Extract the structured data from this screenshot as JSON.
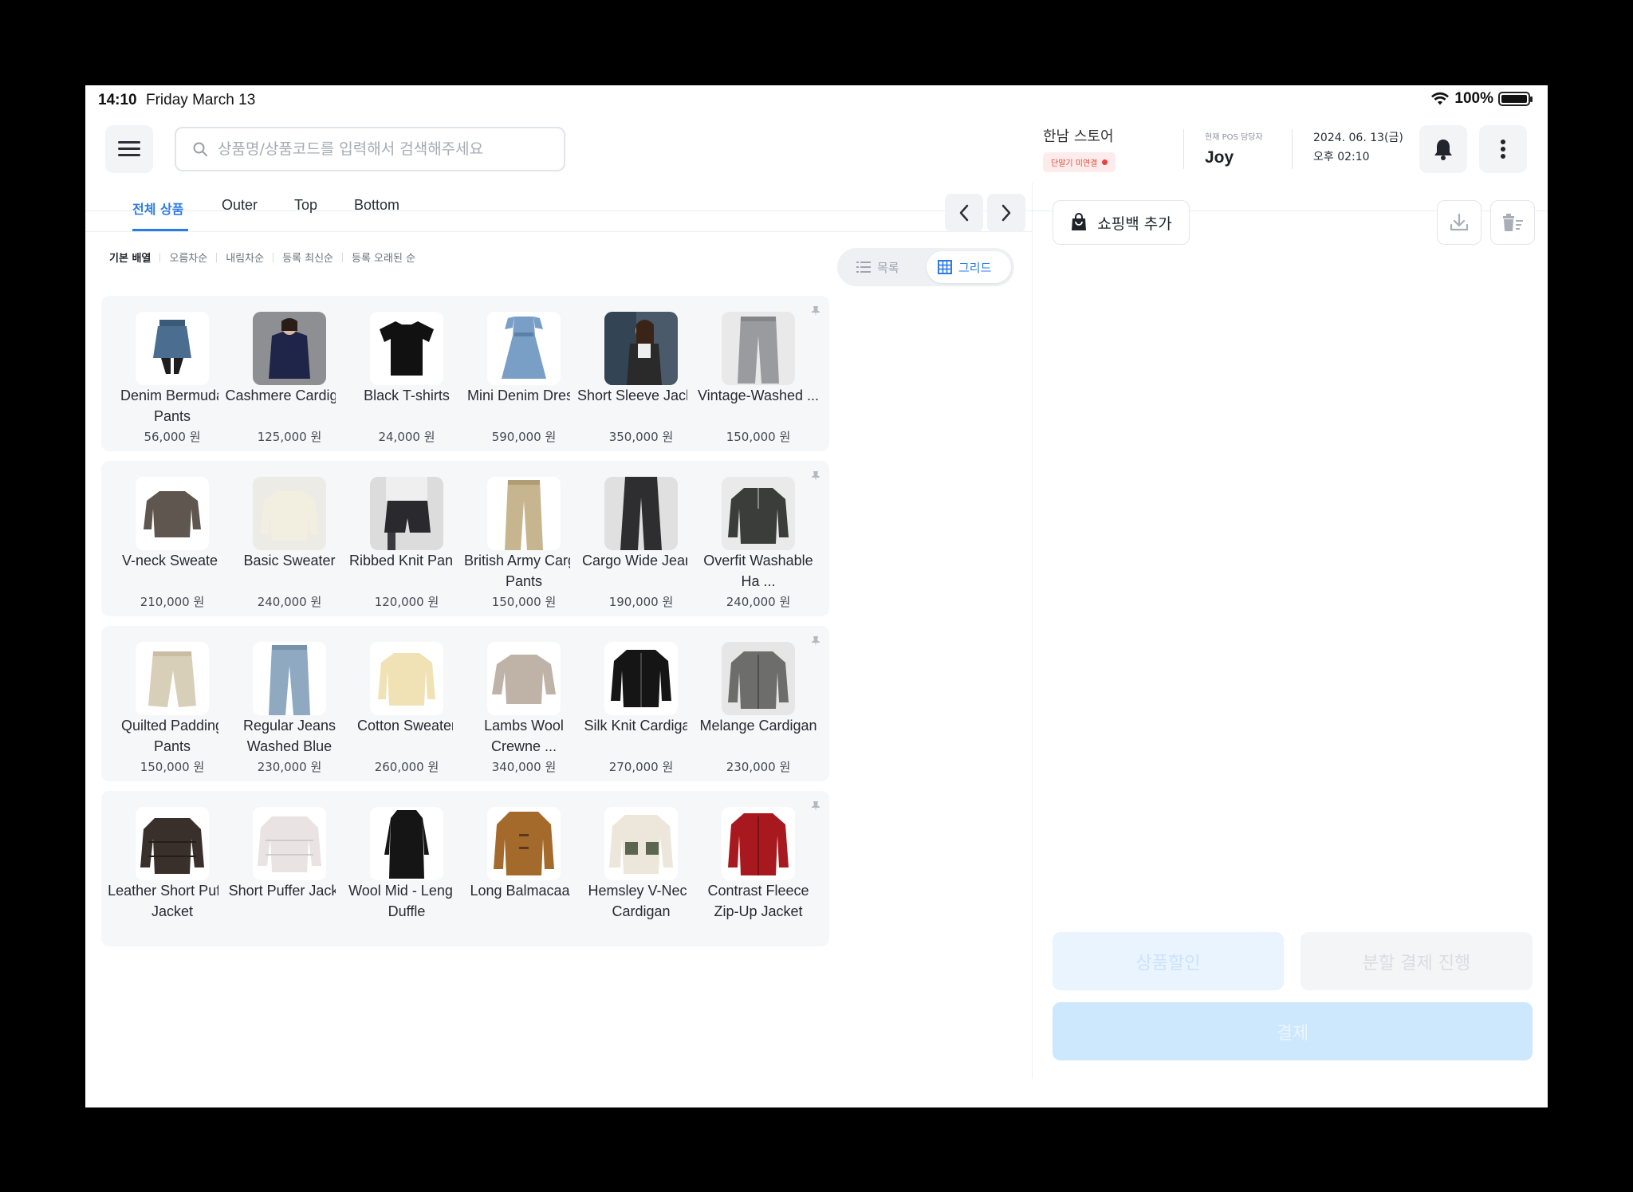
{
  "status_bar": {
    "time": "14:10",
    "date": "Friday March 13",
    "battery": "100%",
    "battery_level": 1.0
  },
  "header": {
    "search_placeholder": "상품명/상품코드를 입력해서 검색해주세요",
    "store_name": "한남 스토어",
    "store_status": "단말기 미연결",
    "staff_label": "현재 POS 담당자",
    "staff_name": "Joy",
    "date": "2024. 06. 13(금)",
    "time": "오후 02:10"
  },
  "tabs": [
    "전체 상품",
    "Outer",
    "Top",
    "Bottom"
  ],
  "active_tab": "전체 상품",
  "sorts": [
    "기본 배열",
    "오름차순",
    "내림차순",
    "등록 최신순",
    "등록 오래된 순"
  ],
  "active_sort": "기본 배열",
  "view": {
    "list_label": "목록",
    "grid_label": "그리드",
    "active": "grid"
  },
  "products": [
    {
      "name": "Denim Bermuda Pants",
      "price": "56,000 원",
      "pinned": true,
      "img": "denim-skirt"
    },
    {
      "name": "Cashmere Cardigan",
      "price": "125,000 원",
      "pinned": true,
      "img": "navy-cardigan"
    },
    {
      "name": "Black T-shirts",
      "price": "24,000 원",
      "pinned": true,
      "img": "black-tshirt"
    },
    {
      "name": "Mini Denim Dress",
      "price": "590,000 원",
      "pinned": false,
      "img": "denim-dress"
    },
    {
      "name": "Short Sleeve Jacket",
      "price": "350,000 원",
      "pinned": false,
      "img": "jacket-photo"
    },
    {
      "name": "Vintage-Washed ...",
      "price": "150,000 원",
      "pinned": false,
      "img": "grey-trousers"
    },
    {
      "name": "V-neck Sweater",
      "price": "210,000 원",
      "pinned": false,
      "img": "brown-sweater"
    },
    {
      "name": "Basic Sweater",
      "price": "240,000 원",
      "pinned": false,
      "img": "cream-sweater"
    },
    {
      "name": "Ribbed Knit Pants",
      "price": "120,000 원",
      "pinned": false,
      "img": "knit-shorts"
    },
    {
      "name": "British Army Cargo Pants",
      "price": "150,000 원",
      "pinned": false,
      "img": "khaki-pants"
    },
    {
      "name": "Cargo Wide Jeans",
      "price": "190,000 원",
      "pinned": false,
      "img": "black-wide-pants"
    },
    {
      "name": "Overfit Washable Ha ...",
      "price": "240,000 원",
      "pinned": false,
      "img": "dark-zip-knit"
    },
    {
      "name": "Quilted Padding Pants",
      "price": "150,000 원",
      "pinned": false,
      "img": "beige-padding-pants"
    },
    {
      "name": "Regular Jeans Washed Blue",
      "price": "230,000 원",
      "pinned": false,
      "img": "blue-jeans"
    },
    {
      "name": "Cotton Sweater",
      "price": "260,000 원",
      "pinned": false,
      "img": "yellow-sweater"
    },
    {
      "name": "Lambs Wool Crewne ...",
      "price": "340,000 원",
      "pinned": false,
      "img": "beige-crewneck"
    },
    {
      "name": "Silk Knit Cardigan",
      "price": "270,000 원",
      "pinned": false,
      "img": "black-cardigan"
    },
    {
      "name": "Melange Cardigan",
      "price": "230,000 원",
      "pinned": false,
      "img": "grey-cardigan"
    },
    {
      "name": "Leather Short Puffer Jacket",
      "price": "",
      "pinned": false,
      "img": "leather-puffer"
    },
    {
      "name": "Short Puffer Jacket",
      "price": "",
      "pinned": false,
      "img": "white-puffer"
    },
    {
      "name": "Wool Mid - Length Duffle",
      "price": "",
      "pinned": false,
      "img": "black-coat"
    },
    {
      "name": "Long Balmacaan",
      "price": "",
      "pinned": false,
      "img": "brown-duffle"
    },
    {
      "name": "Hemsley V-Neck Cardigan",
      "price": "",
      "pinned": false,
      "img": "fleece-cardigan"
    },
    {
      "name": "Contrast Fleece Zip-Up Jacket",
      "price": "",
      "pinned": false,
      "img": "red-cardigan"
    }
  ],
  "right_panel": {
    "shopping_bag": "쇼핑백 추가",
    "discount": "상품할인",
    "split_pay": "분할 결제 진행",
    "checkout": "결제"
  },
  "colors": {
    "accent": "#2c7be5",
    "status_error": "#e8423b"
  }
}
